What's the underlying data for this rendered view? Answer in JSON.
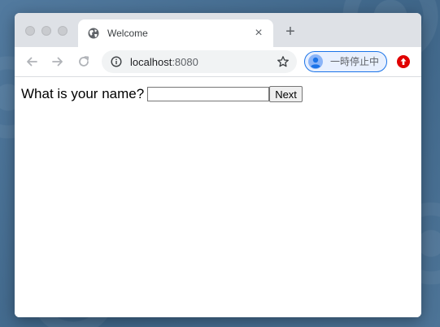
{
  "browser": {
    "tab": {
      "title": "Welcome",
      "favicon": "globe-icon",
      "close_glyph": "×"
    },
    "new_tab_glyph": "+",
    "toolbar": {
      "back": "arrow-left-icon",
      "forward": "arrow-right-icon",
      "reload": "reload-icon"
    },
    "omnibox": {
      "host": "localhost",
      "port": ":8080",
      "info_icon": "info-icon",
      "bookmark_icon": "star-icon"
    },
    "profile": {
      "label": "一時停止中",
      "accent": "#1a73e8"
    },
    "update_icon": {
      "name": "update-arrow-icon",
      "color": "#e00000"
    }
  },
  "page": {
    "question": "What is your name?",
    "name_input": {
      "value": "",
      "placeholder": ""
    },
    "next_label": "Next"
  }
}
